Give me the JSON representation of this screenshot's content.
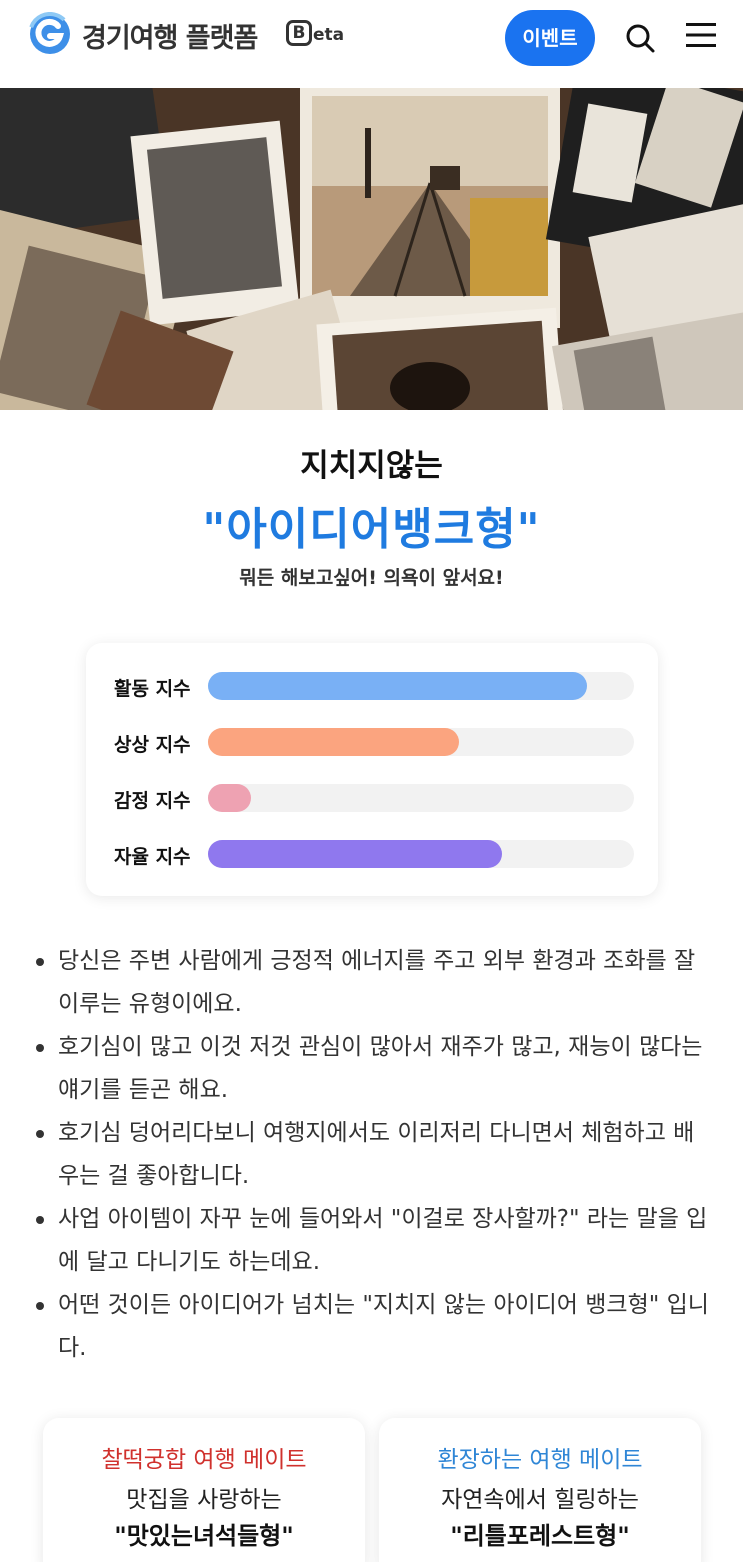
{
  "header": {
    "brand": "경기여행 플랫폼",
    "beta_letter": "B",
    "beta_rest": "eta",
    "event_button": "이벤트",
    "accent_color": "#1a73f0"
  },
  "result": {
    "subtitle": "지치지않는",
    "type_title": "\"아이디어뱅크형\"",
    "tagline": "뭐든 해보고싶어! 의욕이 앞서요!"
  },
  "stats": [
    {
      "label": "활동 지수",
      "fraction": 0.89,
      "color": "#79b0f5"
    },
    {
      "label": "상상 지수",
      "fraction": 0.59,
      "color": "#fba47f"
    },
    {
      "label": "감정 지수",
      "fraction": 0.1,
      "color": "#eea2b2"
    },
    {
      "label": "자율 지수",
      "fraction": 0.69,
      "color": "#8f78ee"
    }
  ],
  "description": [
    "당신은 주변 사람에게 긍정적 에너지를 주고 외부 환경과 조화를 잘 이루는 유형이에요.",
    "호기심이 많고 이것 저것 관심이 많아서 재주가 많고, 재능이 많다는 얘기를 듣곤 해요.",
    "호기심 덩어리다보니 여행지에서도 이리저리 다니면서 체험하고 배우는 걸 좋아합니다.",
    "사업 아이템이 자꾸 눈에 들어와서 \"이걸로 장사할까?\" 라는 말을 입에 달고 다니기도 하는데요.",
    "어떤 것이든 아이디어가 넘치는 \"지치지 않는 아이디어 뱅크형\" 입니다."
  ],
  "mates": [
    {
      "title": "찰떡궁합 여행 메이트",
      "desc": "맛집을 사랑하는",
      "type": "\"맛있는녀석들형\"",
      "color": "#d0312d"
    },
    {
      "title": "환장하는 여행 메이트",
      "desc": "자연속에서 힐링하는",
      "type": "\"리틀포레스트형\"",
      "color": "#2f86d6"
    }
  ]
}
